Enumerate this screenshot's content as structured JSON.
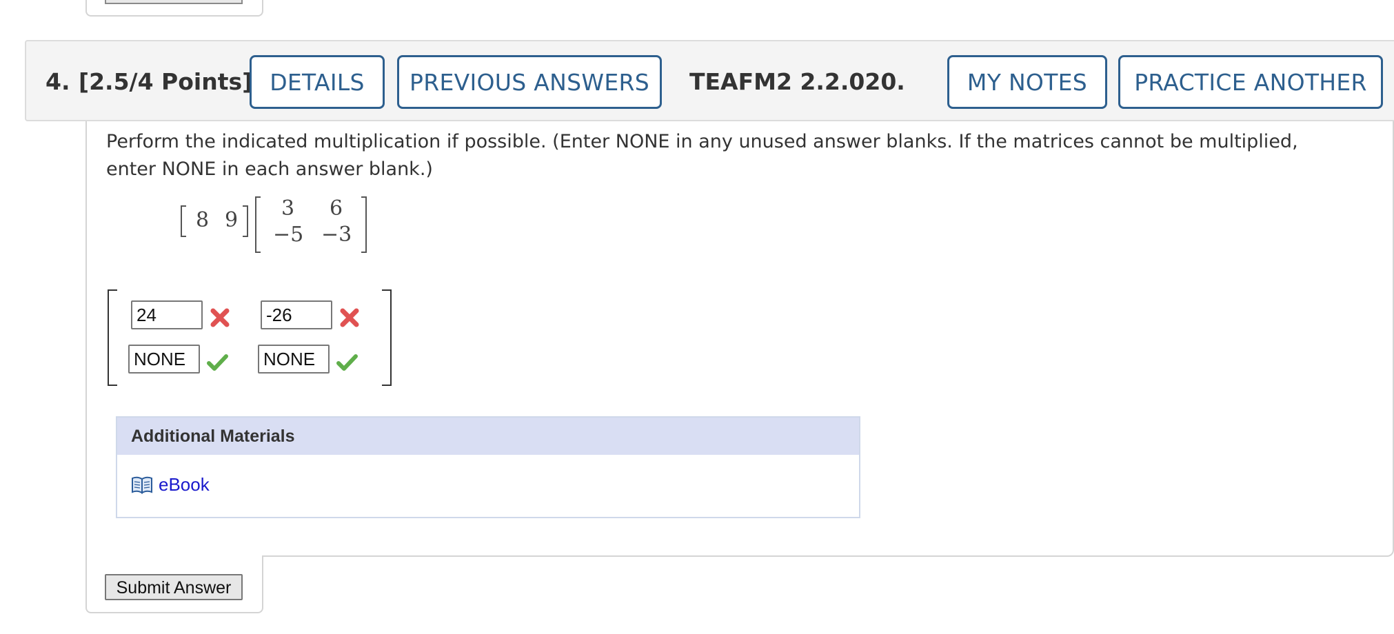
{
  "question": {
    "number": "4.",
    "points": "[2.5/4 Points]",
    "assignment_code": "TEAFM2 2.2.020.",
    "buttons": {
      "details": "DETAILS",
      "previous_answers": "PREVIOUS ANSWERS",
      "my_notes": "MY NOTES",
      "practice_another": "PRACTICE ANOTHER"
    },
    "prompt": "Perform the indicated multiplication if possible. (Enter NONE in any unused answer blanks. If the matrices cannot be multiplied, enter NONE in each answer blank.)",
    "left_matrix": [
      "8",
      "9"
    ],
    "right_matrix": [
      [
        "3",
        "6"
      ],
      [
        "−5",
        "−3"
      ]
    ],
    "answers": [
      {
        "value": "24",
        "status": "incorrect"
      },
      {
        "value": "-26",
        "status": "incorrect"
      },
      {
        "value": "NONE",
        "status": "correct"
      },
      {
        "value": "NONE",
        "status": "correct"
      }
    ]
  },
  "additional_materials": {
    "title": "Additional Materials",
    "items": [
      {
        "label": "eBook",
        "icon": "book-icon"
      }
    ]
  },
  "submit_label": "Submit Answer",
  "colors": {
    "button_blue": "#2d5f8e",
    "materials_header": "#d9def3",
    "link": "#1a1acc",
    "incorrect": "#e05252",
    "correct": "#5fae4a"
  }
}
